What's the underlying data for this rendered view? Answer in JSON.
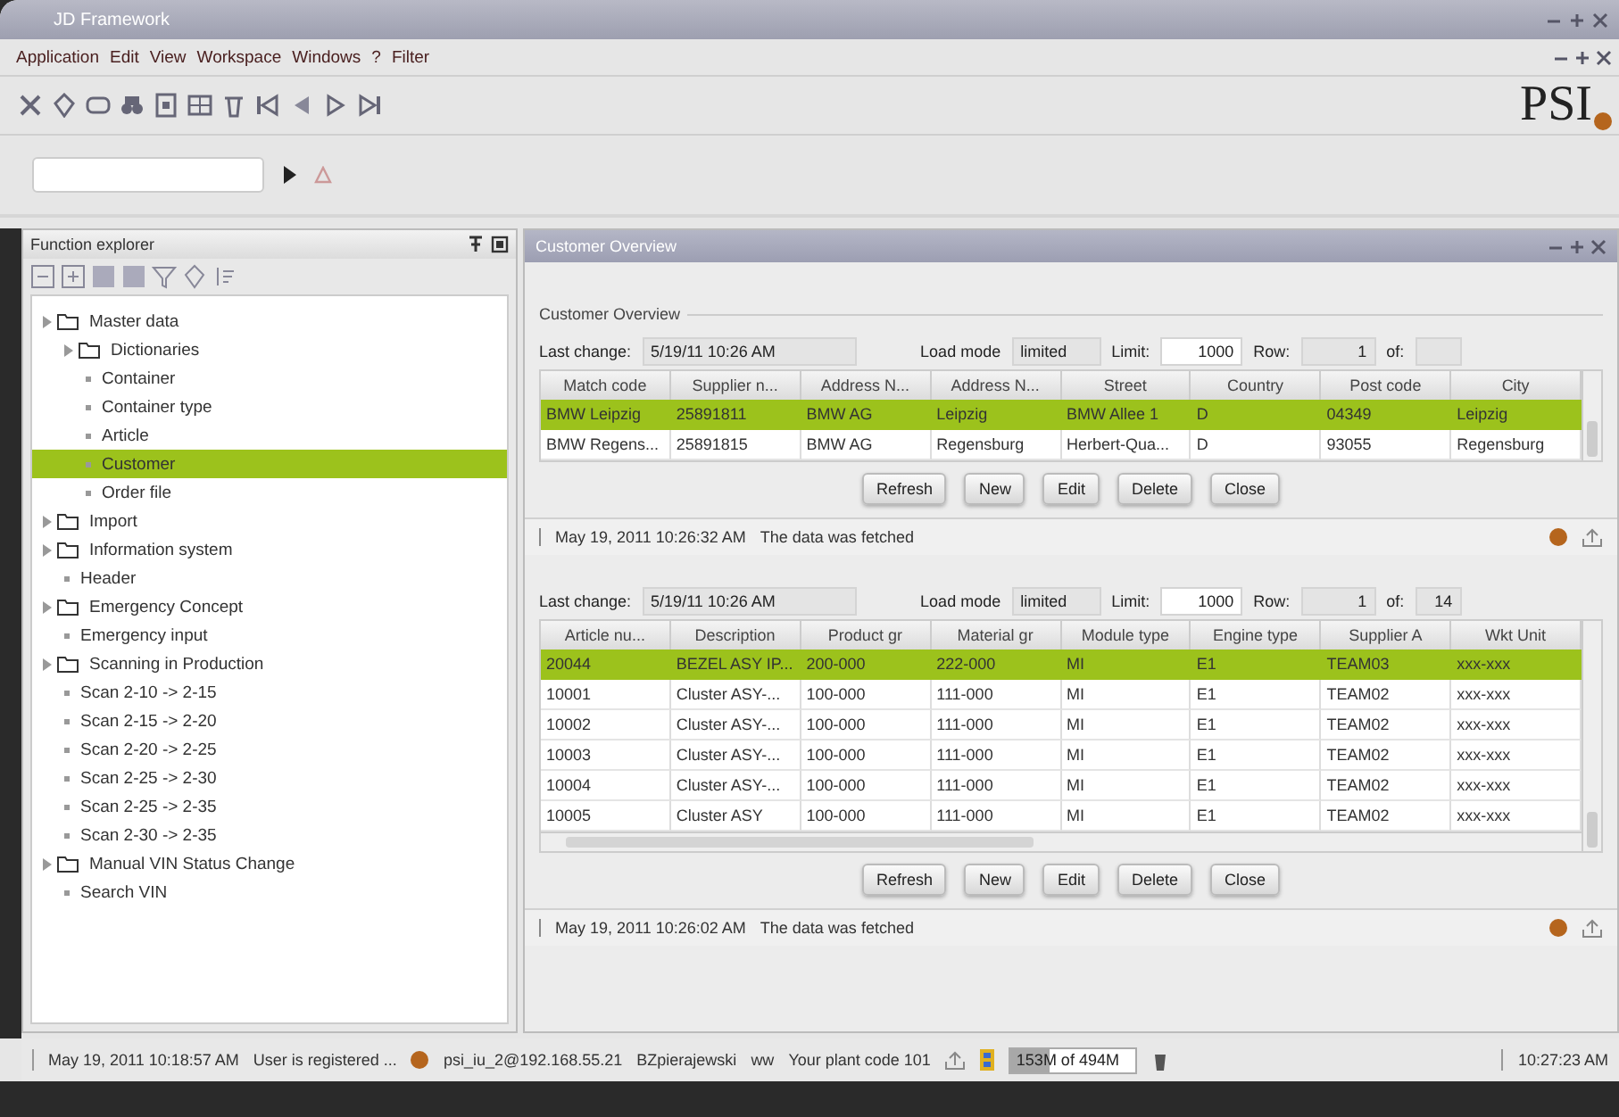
{
  "window": {
    "title": "JD Framework"
  },
  "menu": [
    "Application",
    "Edit",
    "View",
    "Workspace",
    "Windows",
    "?",
    "Filter"
  ],
  "logo": "PSI",
  "explorer": {
    "title": "Function explorer",
    "tree": [
      {
        "label": "Master data",
        "selected": false,
        "children": [
          {
            "label": "Dictionaries",
            "selected": false,
            "children": [
              {
                "label": "Container",
                "selected": false
              },
              {
                "label": "Container type",
                "selected": false
              },
              {
                "label": "Article",
                "selected": false
              },
              {
                "label": "Customer",
                "selected": true
              },
              {
                "label": "Order file",
                "selected": false
              }
            ]
          }
        ]
      },
      {
        "label": "Import",
        "selected": false,
        "kind": "folder"
      },
      {
        "label": "Information system",
        "selected": false,
        "children": [
          {
            "label": "Header",
            "selected": false
          }
        ]
      },
      {
        "label": "Emergency Concept",
        "selected": false,
        "children": [
          {
            "label": "Emergency input",
            "selected": false
          }
        ]
      },
      {
        "label": "Scanning in Production",
        "selected": false,
        "children": [
          {
            "label": "Scan 2-10 -> 2-15",
            "selected": false
          },
          {
            "label": "Scan 2-15 -> 2-20",
            "selected": false
          },
          {
            "label": "Scan 2-20 -> 2-25",
            "selected": false
          },
          {
            "label": "Scan 2-25 -> 2-30",
            "selected": false
          },
          {
            "label": "Scan 2-25 -> 2-35",
            "selected": false
          },
          {
            "label": "Scan 2-30 -> 2-35",
            "selected": false
          }
        ]
      },
      {
        "label": "Manual VIN Status Change",
        "selected": false,
        "children": [
          {
            "label": "Search VIN",
            "selected": false
          }
        ]
      }
    ]
  },
  "overview": {
    "title": "Customer Overview",
    "group": "Customer Overview",
    "sections": [
      {
        "fields": [
          {
            "label": "Last change:",
            "value": "5/19/11 10:26 AM"
          },
          {
            "label": "Load mode",
            "value": "limited"
          },
          {
            "label": "Limit:",
            "value": "1000"
          },
          {
            "label": "Row:",
            "value": "1"
          },
          {
            "label": "of:"
          }
        ],
        "columns": [
          "Match code",
          "Supplier n...",
          "Address N...",
          "Address N...",
          "Street",
          "Country",
          "Post code",
          "City"
        ],
        "rows": [
          {
            "selected": true,
            "cells": [
              "BMW Leipzig",
              "25891811",
              "BMW AG",
              "Leipzig",
              "BMW Allee 1",
              "D",
              "04349",
              "Leipzig"
            ]
          },
          {
            "selected": false,
            "cells": [
              "BMW Regens...",
              "25891815",
              "BMW AG",
              "Regensburg",
              "Herbert-Qua...",
              "D",
              "93055",
              "Regensburg"
            ]
          }
        ],
        "hscroll": false,
        "buttons": [
          "Refresh",
          "New",
          "Edit",
          "Delete",
          "Close"
        ],
        "message": {
          "time": "May 19, 2011 10:26:32 AM",
          "text": "The data was fetched"
        }
      },
      {
        "fields": [
          {
            "label": "Last change:",
            "value": "5/19/11 10:26 AM"
          },
          {
            "label": "Load mode",
            "value": "limited"
          },
          {
            "label": "Limit:",
            "value": "1000"
          },
          {
            "label": "Row:",
            "value": "1"
          },
          {
            "label": "of:",
            "value": "14"
          }
        ],
        "columns": [
          "Article nu...",
          "Description",
          "Product gr",
          "Material gr",
          "Module type",
          "Engine type",
          "Supplier A",
          "Wkt Unit"
        ],
        "rows": [
          {
            "selected": true,
            "cells": [
              "20044",
              "BEZEL ASY IP...",
              "200-000",
              "222-000",
              "MI",
              "E1",
              "TEAM03",
              "xxx-xxx"
            ]
          },
          {
            "selected": false,
            "cells": [
              "10001",
              "Cluster ASY-...",
              "100-000",
              "111-000",
              "MI",
              "E1",
              "TEAM02",
              "xxx-xxx"
            ]
          },
          {
            "selected": false,
            "cells": [
              "10002",
              "Cluster ASY-...",
              "100-000",
              "111-000",
              "MI",
              "E1",
              "TEAM02",
              "xxx-xxx"
            ]
          },
          {
            "selected": false,
            "cells": [
              "10003",
              "Cluster ASY-...",
              "100-000",
              "111-000",
              "MI",
              "E1",
              "TEAM02",
              "xxx-xxx"
            ]
          },
          {
            "selected": false,
            "cells": [
              "10004",
              "Cluster ASY-...",
              "100-000",
              "111-000",
              "MI",
              "E1",
              "TEAM02",
              "xxx-xxx"
            ]
          },
          {
            "selected": false,
            "cells": [
              "10005",
              "Cluster ASY",
              "100-000",
              "111-000",
              "MI",
              "E1",
              "TEAM02",
              "xxx-xxx"
            ]
          }
        ],
        "hscroll": true,
        "buttons": [
          "Refresh",
          "New",
          "Edit",
          "Delete",
          "Close"
        ],
        "message": {
          "time": "May 19, 2011 10:26:02 AM",
          "text": "The data was fetched"
        }
      }
    ]
  },
  "status_bar": {
    "timestamp": "May 19, 2011 10:18:57 AM",
    "message": "User is registered ...",
    "connection": "psi_iu_2@192.168.55.21",
    "user": "BZpierajewski",
    "mode": "ww",
    "plant": "Your plant code 101",
    "memory": {
      "text": "153M of 494M",
      "level": 0.31
    },
    "time": "10:27:23 AM"
  }
}
